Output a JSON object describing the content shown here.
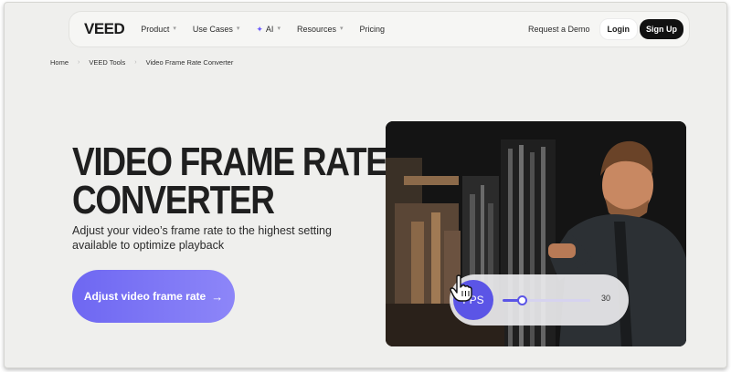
{
  "nav": {
    "logo": "VEED",
    "items": [
      {
        "label": "Product",
        "has_dropdown": true
      },
      {
        "label": "Use Cases",
        "has_dropdown": true
      },
      {
        "label": "AI",
        "has_dropdown": true
      },
      {
        "label": "Resources",
        "has_dropdown": true
      },
      {
        "label": "Pricing",
        "has_dropdown": false
      }
    ],
    "request_demo": "Request a Demo",
    "login": "Login",
    "signup": "Sign Up",
    "accent_color": "#6d5dfc"
  },
  "breadcrumb": [
    "Home",
    "VEED Tools",
    "Video Frame Rate Converter"
  ],
  "hero": {
    "title_line1": "VIDEO FRAME RATE",
    "title_line2": "CONVERTER",
    "subtitle": "Adjust your video’s frame rate to the highest setting available to optimize playback",
    "cta_label": "Adjust video frame rate",
    "cta_arrow": "→",
    "cta_color": "#6e67f2"
  },
  "media": {
    "fps_label": "FPS",
    "slider_value": "30",
    "slider_level": 0.22
  }
}
